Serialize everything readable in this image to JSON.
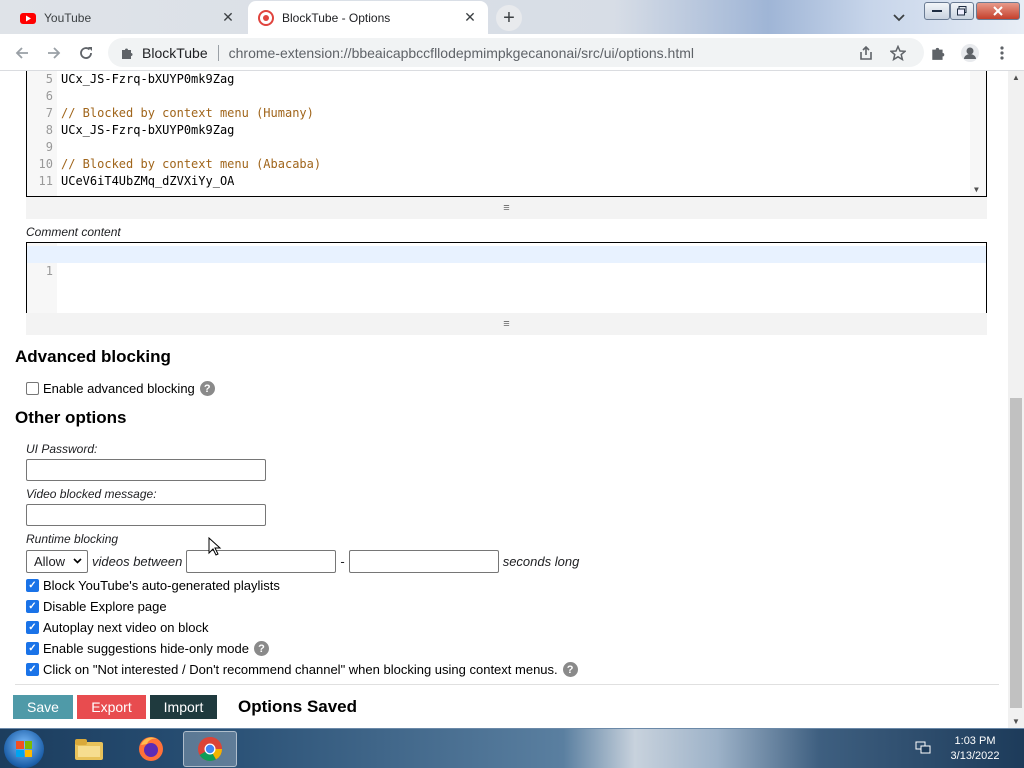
{
  "browser": {
    "tabs": [
      {
        "title": "YouTube",
        "close": "✕"
      },
      {
        "title": "BlockTube - Options",
        "close": "✕"
      }
    ],
    "new_tab": "+",
    "address": {
      "site_label": "BlockTube",
      "url": "chrome-extension://bbeaicapbccfllodepmimpkgecanonai/src/ui/options.html"
    }
  },
  "channel_editor": {
    "lines": [
      {
        "n": "5",
        "text": "UCx_JS-Fzrq-bXUYP0mk9Zag",
        "comment": false
      },
      {
        "n": "6",
        "text": "",
        "comment": false
      },
      {
        "n": "7",
        "text": "// Blocked by context menu (Humany)",
        "comment": true
      },
      {
        "n": "8",
        "text": "UCx_JS-Fzrq-bXUYP0mk9Zag",
        "comment": false
      },
      {
        "n": "9",
        "text": "",
        "comment": false
      },
      {
        "n": "10",
        "text": "// Blocked by context menu (Abacaba)",
        "comment": true
      },
      {
        "n": "11",
        "text": "UCeV6iT4UbZMq_dZVXiYy_OA",
        "comment": false
      }
    ]
  },
  "comment_content": {
    "label": "Comment content",
    "first_line": "1"
  },
  "advanced": {
    "heading": "Advanced blocking",
    "enable_label": "Enable advanced blocking"
  },
  "other": {
    "heading": "Other options",
    "ui_password_label": "UI Password:",
    "video_blocked_label": "Video blocked message:",
    "runtime_label": "Runtime blocking",
    "runtime_select": "Allow",
    "runtime_between": "videos between",
    "runtime_dash": "-",
    "runtime_suffix": "seconds long",
    "checkboxes": [
      {
        "label": "Block YouTube's auto-generated playlists",
        "checked": true,
        "help": false
      },
      {
        "label": "Disable Explore page",
        "checked": true,
        "help": false
      },
      {
        "label": "Autoplay next video on block",
        "checked": true,
        "help": false
      },
      {
        "label": "Enable suggestions hide-only mode",
        "checked": true,
        "help": true
      },
      {
        "label": "Click on \"Not interested / Don't recommend channel\" when blocking using context menus.",
        "checked": true,
        "help": true
      }
    ]
  },
  "actions": {
    "save": "Save",
    "export": "Export",
    "import": "Import",
    "status": "Options Saved"
  },
  "taskbar": {
    "time": "1:03 PM",
    "date": "3/13/2022"
  },
  "colors": {
    "save": "#4f9aa8",
    "export": "#e84c4f",
    "import": "#1f3a3e",
    "comment_text": "#a0651b",
    "checkbox": "#1a73e8"
  }
}
